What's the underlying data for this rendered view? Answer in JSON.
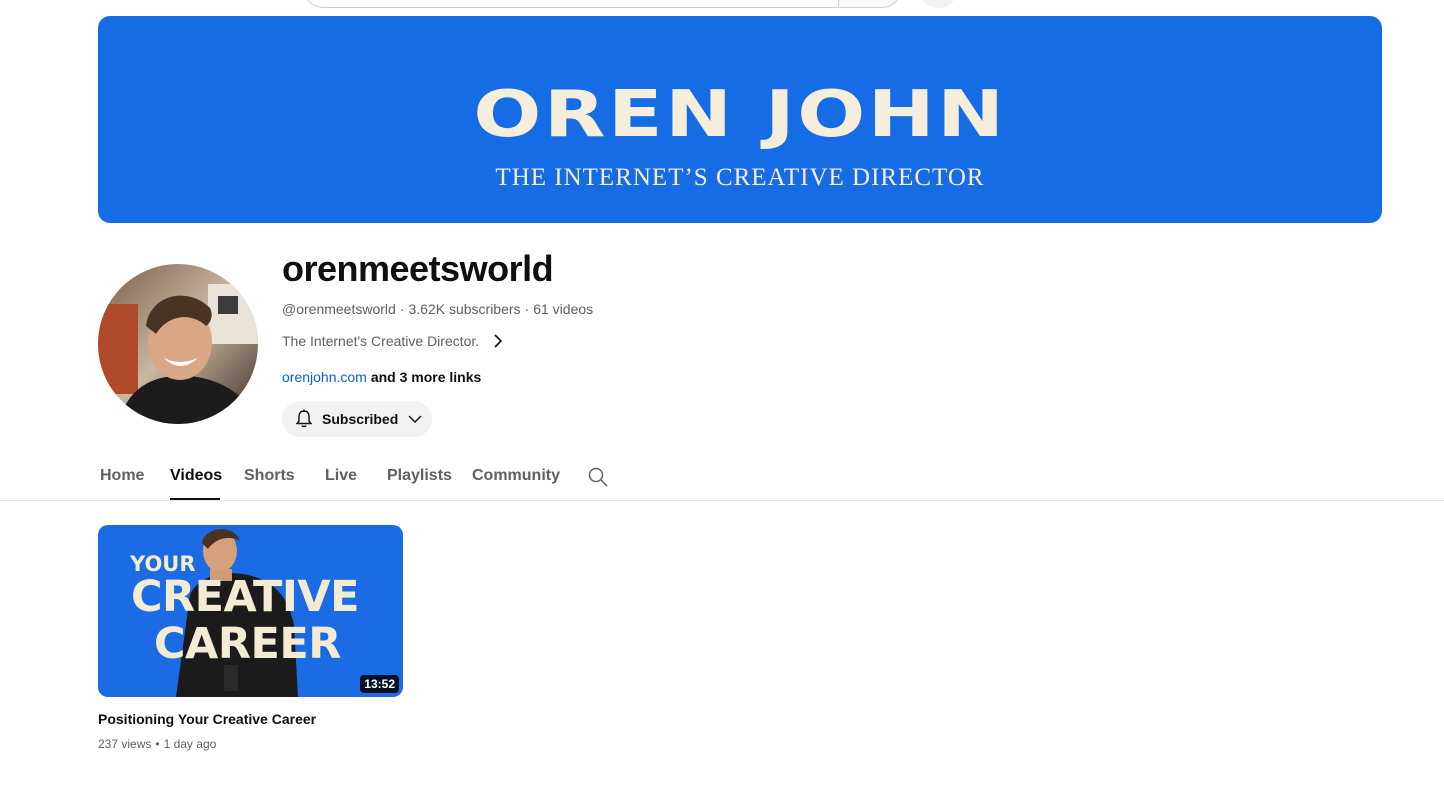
{
  "banner": {
    "title": "OREN JOHN",
    "subtitle": "THE INTERNET’S CREATIVE DIRECTOR",
    "background": "#156ce5",
    "text_color": "#f6eedd"
  },
  "channel": {
    "name": "orenmeetsworld",
    "handle": "@orenmeetsworld",
    "subscribers": "3.62K subscribers",
    "videos": "61 videos",
    "separator": "·",
    "description": "The Internet's Creative Director.",
    "link_primary": "orenjohn.com",
    "link_more": "and 3 more links",
    "avatar_icon": "avatar-photo"
  },
  "subscribe": {
    "label": "Subscribed",
    "icon": "bell-icon",
    "caret_icon": "chevron-down-icon"
  },
  "tabs": [
    {
      "label": "Home",
      "active": false
    },
    {
      "label": "Videos",
      "active": true
    },
    {
      "label": "Shorts",
      "active": false
    },
    {
      "label": "Live",
      "active": false
    },
    {
      "label": "Playlists",
      "active": false
    },
    {
      "label": "Community",
      "active": false
    }
  ],
  "videos": [
    {
      "thumb_line1": "YOUR",
      "thumb_line2": "CREATIVE",
      "thumb_line3": "CAREER",
      "duration": "13:52",
      "title": "Positioning Your Creative Career",
      "views": "237 views",
      "age": "1 day ago",
      "separator": "•"
    }
  ],
  "colors": {
    "link": "#065fd4",
    "muted": "#606060",
    "text": "#0f0f0f"
  }
}
